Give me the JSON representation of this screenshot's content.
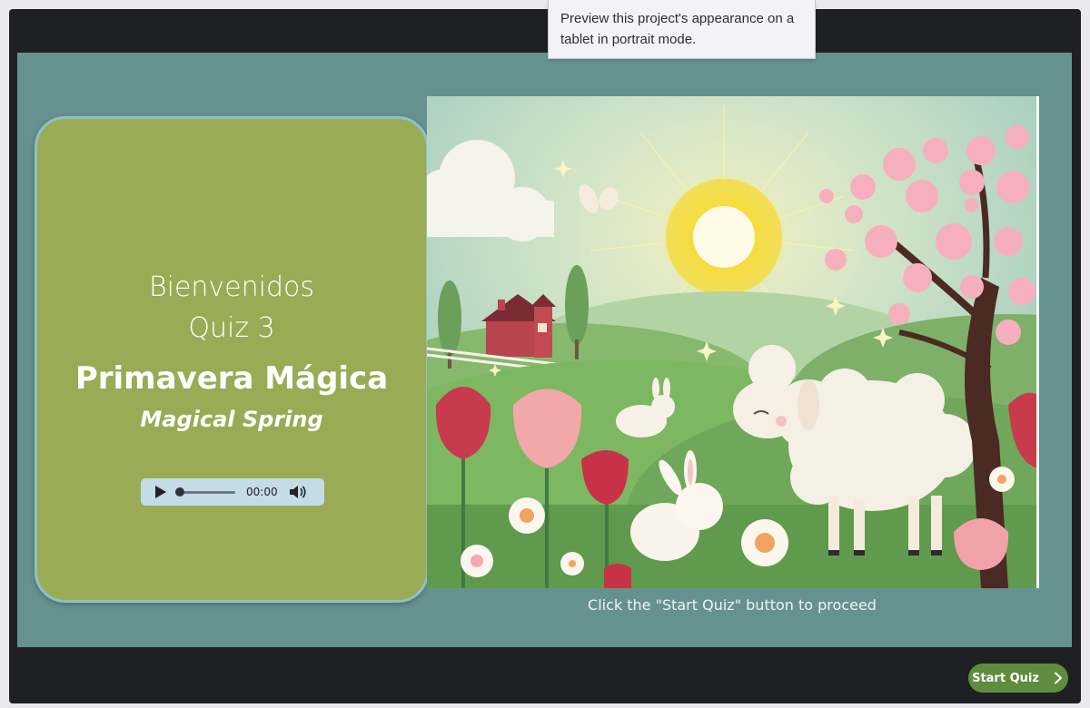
{
  "tooltip": {
    "text": "Preview this project's appearance on a tablet in portrait mode."
  },
  "title_card": {
    "welcome": "Bienvenidos",
    "quiz_label": "Quiz 3",
    "title": "Primavera Mágica",
    "subtitle": "Magical Spring"
  },
  "audio_player": {
    "time": "00:00",
    "progress": 0
  },
  "scene_image": {
    "icon": "spring-meadow-illustration"
  },
  "instructions": {
    "text": "Click the \"Start Quiz\" button to proceed"
  },
  "start_button": {
    "label": "Start Quiz",
    "icon": "chevron-right-icon"
  },
  "colors": {
    "stage_bg": "#669191",
    "card_bg": "#9aab55",
    "card_border": "#8fc0c4",
    "start_button": "#5d8d3d",
    "frame_bg": "#1f2024"
  }
}
